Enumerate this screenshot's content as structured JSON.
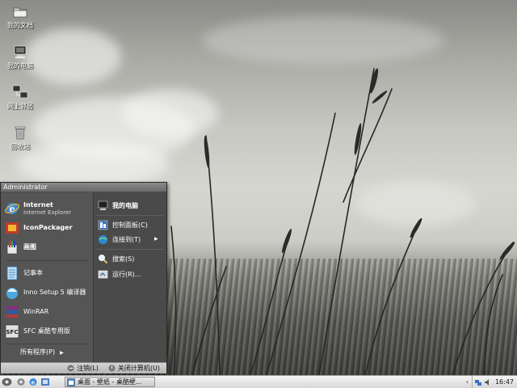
{
  "desktop": {
    "icons": [
      {
        "label": "我的文档",
        "icon": "folder-icon"
      },
      {
        "label": "我的电脑",
        "icon": "computer-icon"
      },
      {
        "label": "网上邻居",
        "icon": "network-icon"
      },
      {
        "label": "回收站",
        "icon": "recycle-bin-icon"
      }
    ]
  },
  "start_menu": {
    "user": "Administrator",
    "pinned": [
      {
        "title": "Internet",
        "subtitle": "Internet Explorer",
        "icon": "internet-explorer-icon"
      },
      {
        "title": "IconPackager",
        "icon": "iconpackager-icon"
      },
      {
        "title": "画图",
        "icon": "paint-icon"
      }
    ],
    "recent": [
      {
        "title": "记事本",
        "icon": "notepad-icon"
      },
      {
        "title": "Inno Setup 5 编译器",
        "icon": "inno-setup-icon"
      },
      {
        "title": "WinRAR",
        "icon": "winrar-icon"
      },
      {
        "title": "SFC 桌酷专用版",
        "icon": "sfc-icon"
      }
    ],
    "all_programs": "所有程序(P)",
    "right": [
      {
        "label": "我的电脑",
        "icon": "computer-icon"
      },
      {
        "label": "控制面板(C)",
        "icon": "control-panel-icon"
      },
      {
        "label": "连接到(T)",
        "icon": "connect-icon"
      },
      {
        "label": "搜索(S)",
        "icon": "search-icon"
      },
      {
        "label": "运行(R)...",
        "icon": "run-icon"
      }
    ],
    "logoff": "注销(L)",
    "shutdown": "关闭计算机(U)"
  },
  "taskbar": {
    "task_label": "桌面 - 壁纸 - 桌酷壁...",
    "clock": "16:47",
    "tray_chevron": "‹"
  },
  "colors": {
    "menu_left": "#555555",
    "menu_right": "#4a4a4a",
    "taskbar": "#e4e4e4"
  }
}
